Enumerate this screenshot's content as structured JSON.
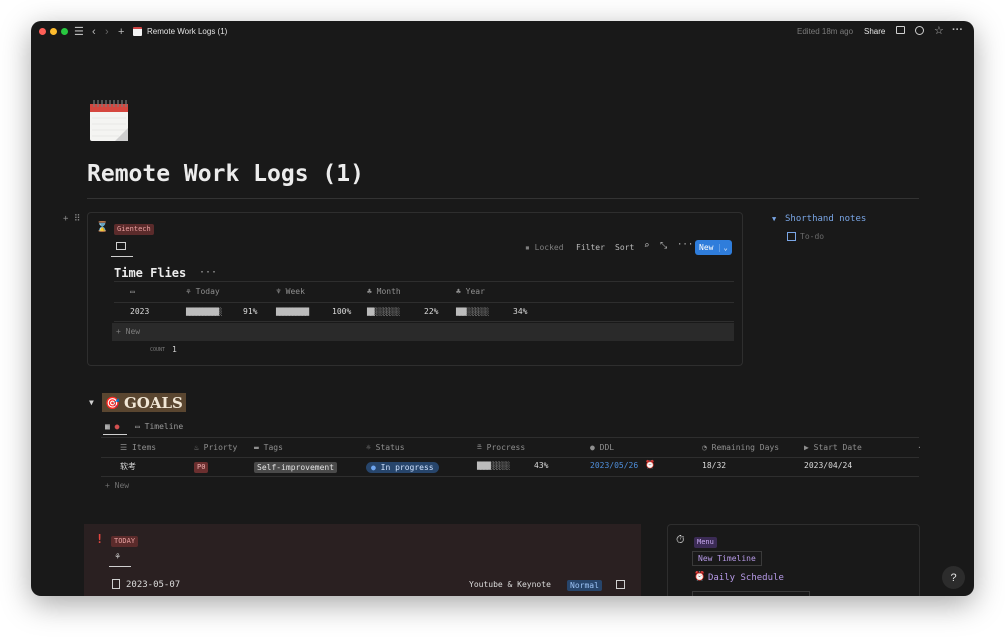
{
  "titlebar": {
    "page_title": "Remote Work Logs (1)",
    "edited": "Edited 18m ago",
    "share": "Share"
  },
  "page": {
    "title": "Remote Work Logs (1)"
  },
  "time_db": {
    "source_tag": "Gientech",
    "locked": "Locked",
    "filter": "Filter",
    "sort": "Sort",
    "new_button": "New",
    "view_title": "Time Flies",
    "columns": [
      "Today",
      "Week",
      "Month",
      "Year"
    ],
    "row": {
      "year": "2023",
      "today": {
        "bar": "██████████░",
        "pct": "91%",
        "value": 0.91
      },
      "week": {
        "bar": "██████████",
        "pct": "100%",
        "value": 1.0
      },
      "month": {
        "bar": "██░░░░░░░░",
        "pct": "22%",
        "value": 0.22
      },
      "year_progress": {
        "bar": "███░░░░░░░",
        "pct": "34%",
        "value": 0.34
      }
    },
    "add_new": "+ New",
    "count_label": "COUNT",
    "count_value": "1"
  },
  "shorthand": {
    "title": "Shorthand notes",
    "todo": "To-do"
  },
  "goals": {
    "heading": "GOALS",
    "tab_timeline": "Timeline",
    "columns": [
      "Items",
      "Priorty",
      "Tags",
      "Status",
      "Procress",
      "DDL",
      "Remaining Days",
      "Start Date"
    ],
    "row": {
      "item": "软考",
      "priority": "P0",
      "tag": "Self-improvement",
      "status": "In progress",
      "progress_bar": "████░░░░░░",
      "progress_pct": "43%",
      "progress_value": 0.43,
      "ddl": "2023/05/26",
      "remaining": "18/32",
      "start": "2023/04/24"
    },
    "add_new": "+ New"
  },
  "today": {
    "tag": "TODAY",
    "date": "2023-05-07",
    "task": "Youtube & Keynote",
    "badge": "Normal"
  },
  "menu": {
    "tag": "Menu",
    "new_timeline": "New Timeline",
    "daily_schedule": "Daily Schedule"
  },
  "help": "?"
}
